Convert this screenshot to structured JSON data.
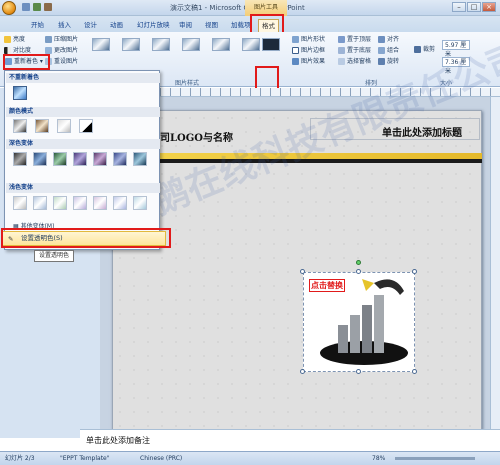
{
  "window": {
    "title": "演示文稿1 - Microsoft Office PowerPoint",
    "contextual_tab_group": "图片工具"
  },
  "ribbon_tabs": [
    "开始",
    "插入",
    "设计",
    "动画",
    "幻灯片放映",
    "审阅",
    "视图",
    "加载项",
    "格式"
  ],
  "active_tab": "格式",
  "adjust_group": {
    "brightness": "亮度",
    "contrast": "对比度",
    "recolor": "重新着色",
    "compress": "压缩图片",
    "change_picture": "更改图片",
    "reset_picture": "重设图片"
  },
  "picture_styles_group": {
    "label": "图片样式",
    "shape": "图片形状",
    "border": "图片边框",
    "effects": "图片效果"
  },
  "arrange_group": {
    "label": "排列",
    "bring_front": "置于顶层",
    "send_back": "置于底层",
    "selection_pane": "选择窗格",
    "align": "对齐",
    "group": "组合",
    "rotate": "旋转"
  },
  "size_group": {
    "label": "大小",
    "crop": "裁剪",
    "height": "5.97 厘米",
    "width": "7.36 厘米"
  },
  "recolor_menu": {
    "no_recolor": "不重新着色",
    "color_modes": "颜色模式",
    "dark_variations": "深色变体",
    "light_variations": "浅色变体",
    "more_variations": "其他变体(M)",
    "set_transparent": "设置透明色(S)",
    "tooltip": "设置透明色"
  },
  "slide": {
    "logo_text": "司LOGO与名称",
    "title_placeholder": "单击此处添加标题",
    "picture_label": "点击替换"
  },
  "watermark": "天鹅在线科技有限责任公司 www.sppt.com.cn",
  "notes_placeholder": "单击此处添加备注",
  "status": {
    "slide": "幻灯片 2/3",
    "theme": "\"EPPT Template\"",
    "language": "Chinese (PRC)",
    "zoom": "78%"
  },
  "colors": {
    "highlight_red": "#e11a1a",
    "ribbon_blue": "#dce7f5",
    "menu_hover": "#fde59c",
    "slide_band": "#f4d54e"
  }
}
